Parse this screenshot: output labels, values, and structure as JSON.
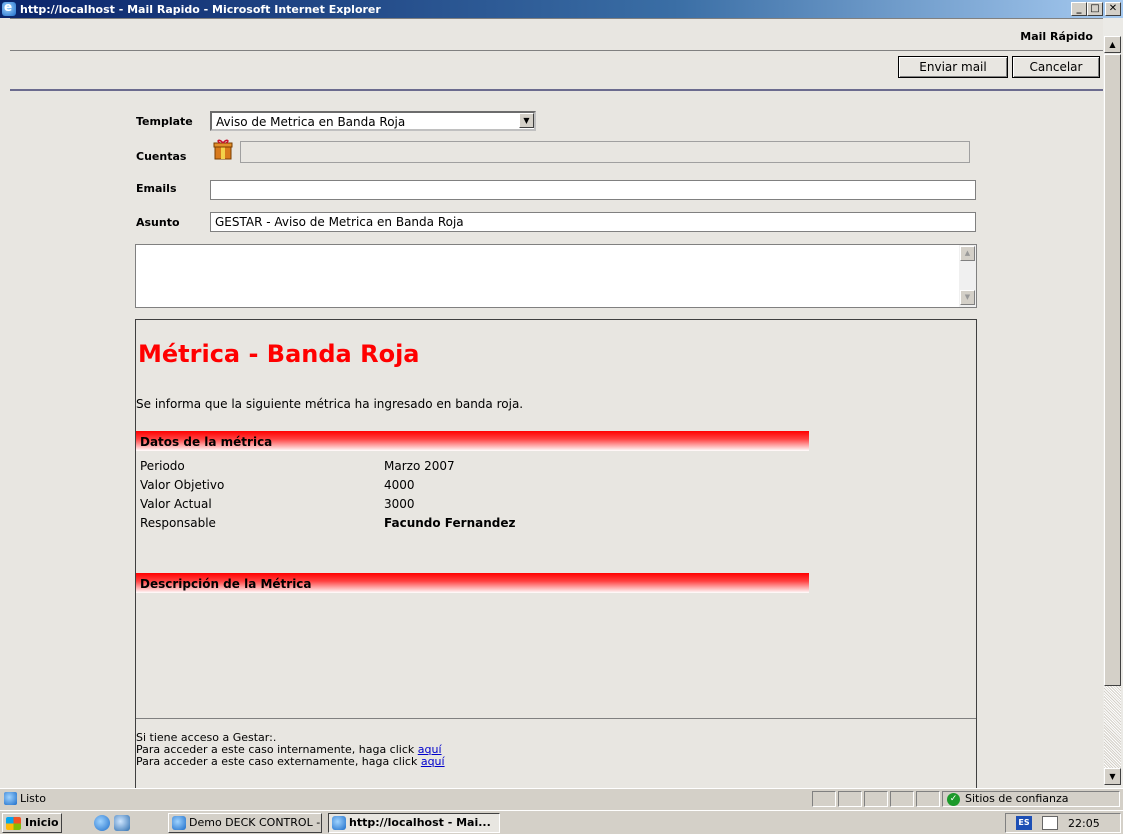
{
  "window": {
    "title": "http://localhost - Mail Rapido - Microsoft Internet Explorer",
    "min_label": "_",
    "max_label": "□",
    "close_label": "✕"
  },
  "header": {
    "title": "Mail Rápido"
  },
  "toolbar": {
    "send_label": "Enviar mail",
    "cancel_label": "Cancelar"
  },
  "form": {
    "template_label": "Template",
    "template_value": "Aviso de Metrica en Banda Roja",
    "accounts_label": "Cuentas",
    "accounts_value": "",
    "emails_label": "Emails",
    "emails_value": "",
    "subject_label": "Asunto",
    "subject_value": "GESTAR - Aviso de Metrica en Banda Roja",
    "body_value": ""
  },
  "preview": {
    "title": "Métrica - Banda Roja",
    "intro": "Se informa que la siguiente métrica ha ingresado en banda roja.",
    "section1_title": "Datos de la métrica",
    "rows": [
      {
        "label": "Periodo",
        "value": "Marzo 2007"
      },
      {
        "label": "Valor Objetivo",
        "value": "4000"
      },
      {
        "label": "Valor Actual",
        "value": "3000"
      },
      {
        "label": "Responsable",
        "value": "Facundo Fernandez"
      }
    ],
    "section2_title": "Descripción de la Métrica",
    "footer": {
      "line1": "Si tiene acceso a Gestar:.",
      "line2": "Para acceder a este caso internamente, haga click ",
      "line3": "Para acceder a este caso externamente, haga click ",
      "link_label": "aquí"
    }
  },
  "statusbar": {
    "status": "Listo",
    "zone": "Sitios de confianza"
  },
  "taskbar": {
    "start_label": "Inicio",
    "tasks": [
      {
        "label": "Demo DECK CONTROL - ..."
      },
      {
        "label": "http://localhost - Mai..."
      }
    ],
    "lang": "ES",
    "clock": "22:05"
  }
}
